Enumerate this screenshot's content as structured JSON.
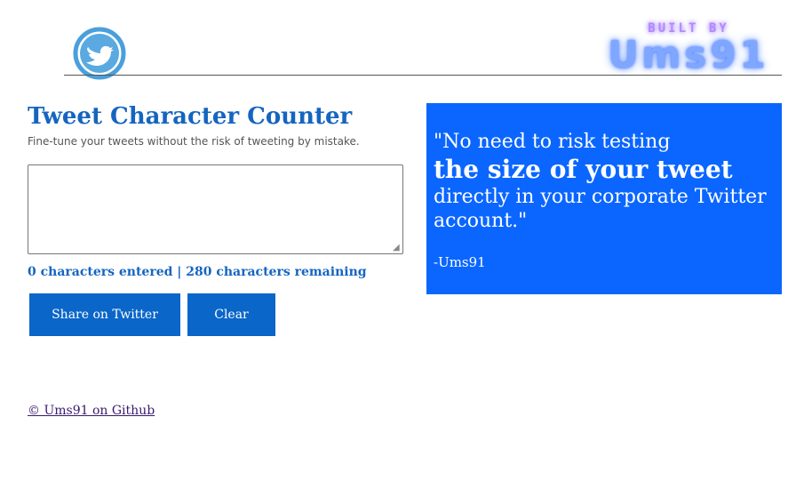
{
  "header": {
    "logo_icon": "twitter-bird-icon",
    "badge_top": "BUILT BY",
    "badge_name": "Ums91"
  },
  "main": {
    "title": "Tweet Character Counter",
    "subtitle": "Fine-tune your tweets without the risk of tweeting by mistake.",
    "tweet_value": "",
    "counter": "0 characters entered | 280 characters remaining",
    "share_label": "Share on Twitter",
    "clear_label": "Clear"
  },
  "quote": {
    "line1": "\"No need to risk testing",
    "line2": "the size of your tweet",
    "line3": "directly in your corporate Twitter account.\"",
    "author": "-Ums91"
  },
  "footer": {
    "link_text": "© Ums91 on Github"
  },
  "colors": {
    "accent": "#1565c0",
    "button": "#0a66c8",
    "quote_bg": "#0a66ff"
  }
}
